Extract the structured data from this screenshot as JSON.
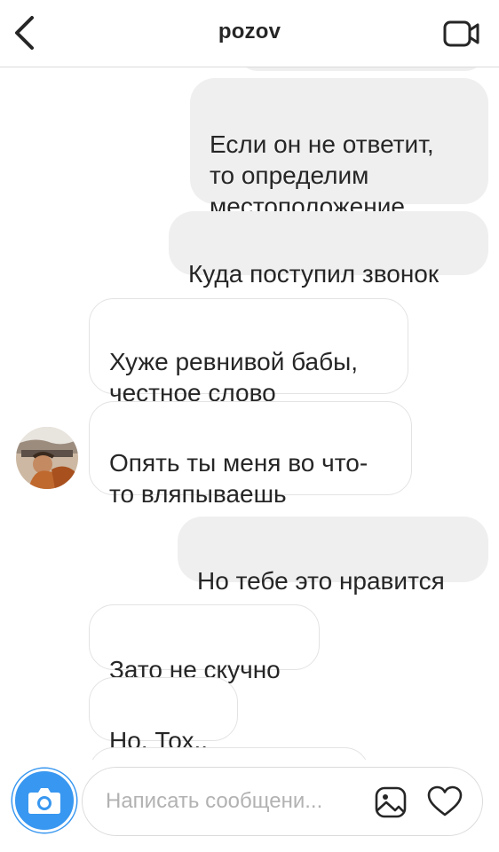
{
  "header": {
    "title": "pozov",
    "back_icon": "chevron-left-icon",
    "video_icon": "video-camera-icon"
  },
  "messages": [
    {
      "side": "outgoing",
      "text": "Если он не ответит,\nто определим\nместоположение"
    },
    {
      "side": "outgoing",
      "text": "Куда поступил звонок"
    },
    {
      "side": "incoming",
      "text": "Хуже ревнивой бабы,\nчестное слово"
    },
    {
      "side": "incoming",
      "text": "Опять ты меня во что-\nто вляпываешь"
    },
    {
      "side": "outgoing",
      "text": "Но тебе это нравится"
    },
    {
      "side": "incoming",
      "text": "Зато не скучно"
    },
    {
      "side": "incoming",
      "text": "Но, Тох.."
    }
  ],
  "composer": {
    "placeholder": "Написать сообщени...",
    "camera_icon": "camera-icon",
    "gallery_icon": "gallery-icon",
    "heart_icon": "heart-icon"
  },
  "colors": {
    "accent": "#3897f0",
    "outgoing_bubble": "#efefef",
    "incoming_border": "#e3e3e3"
  }
}
